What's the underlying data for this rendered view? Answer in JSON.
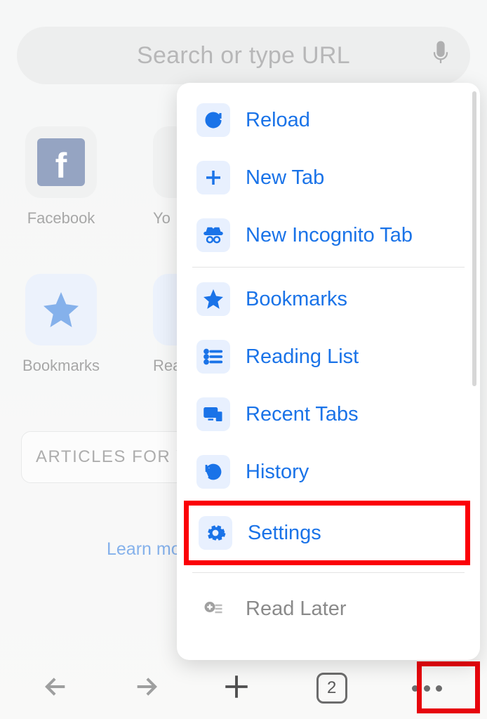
{
  "search": {
    "placeholder": "Search or type URL"
  },
  "favorites": [
    {
      "label": "Facebook"
    },
    {
      "label": "Yo"
    },
    {
      "label": "Bookmarks"
    },
    {
      "label": "Rea"
    }
  ],
  "articles_header": "ARTICLES FOR YO",
  "learn_more": "Learn mor",
  "toolbar": {
    "tab_count": "2"
  },
  "menu": {
    "items": [
      {
        "label": "Reload"
      },
      {
        "label": "New Tab"
      },
      {
        "label": "New Incognito Tab"
      },
      {
        "label": "Bookmarks"
      },
      {
        "label": "Reading List"
      },
      {
        "label": "Recent Tabs"
      },
      {
        "label": "History"
      },
      {
        "label": "Settings"
      },
      {
        "label": "Read Later"
      }
    ]
  }
}
